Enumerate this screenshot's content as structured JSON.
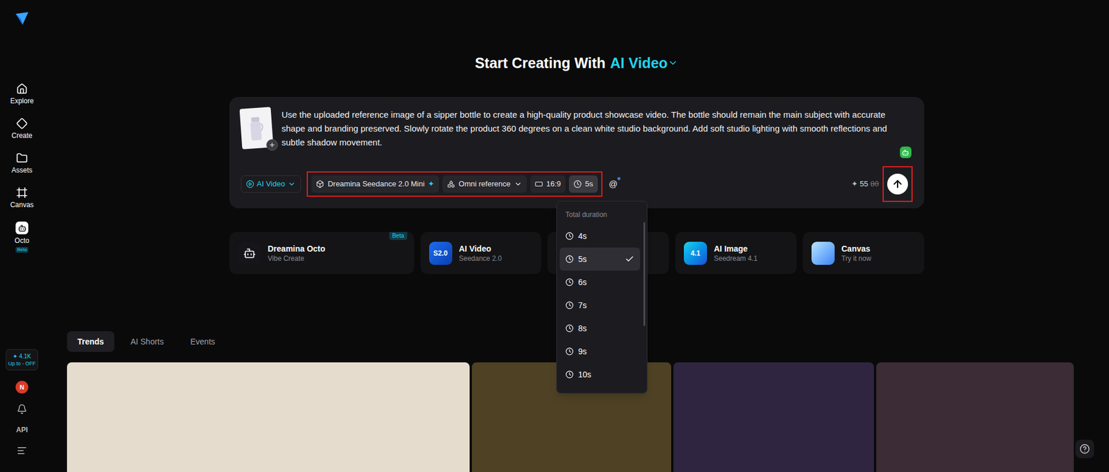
{
  "sidebar": {
    "items": [
      {
        "label": "Explore",
        "selected": false
      },
      {
        "label": "Create",
        "selected": false
      },
      {
        "label": "Assets",
        "selected": false
      },
      {
        "label": "Canvas",
        "selected": false
      },
      {
        "label": "Octo",
        "selected": false,
        "badge": "Beta"
      }
    ],
    "credits": {
      "icon": "✦",
      "amount": "4.1K",
      "promo": "Up to - OFF"
    },
    "avatar": "N",
    "api": "API"
  },
  "header": {
    "title": "Start Creating With",
    "mode": "AI Video"
  },
  "prompt": {
    "text": "Use the uploaded reference image of a sipper bottle to create a high-quality product showcase video. The bottle should remain the main subject with accurate shape and branding preserved. Slowly rotate the product 360 degrees on a clean white studio background. Add soft studio lighting with smooth reflections and subtle shadow movement.",
    "toolbar": {
      "mode": "AI Video",
      "outlined": true,
      "model": "Dreamina Seedance 2.0 Mini",
      "model_mark": "✦",
      "reference": "Omni reference",
      "ratio": "16:9",
      "duration": "5s",
      "duration_open": true,
      "mention": "@"
    },
    "cost": {
      "icon": "✦",
      "price": "55",
      "original_price": "80"
    },
    "send": {
      "outlined": true
    }
  },
  "duration_menu": {
    "title": "Total duration",
    "options": [
      {
        "label": "4s",
        "selected": false
      },
      {
        "label": "5s",
        "selected": true
      },
      {
        "label": "6s",
        "selected": false
      },
      {
        "label": "7s",
        "selected": false
      },
      {
        "label": "8s",
        "selected": false
      },
      {
        "label": "9s",
        "selected": false
      },
      {
        "label": "10s",
        "selected": false
      }
    ]
  },
  "feature_cards": [
    {
      "title": "Dreamina Octo",
      "subtitle": "Vibe Create",
      "badge": "Beta",
      "icon_text": "",
      "covered": false
    },
    {
      "title": "AI Video",
      "subtitle": "Seedance 2.0",
      "badge": "",
      "icon_text": "S2.0",
      "covered": false
    },
    {
      "title": "",
      "subtitle": "",
      "badge": "",
      "icon_text": "",
      "covered": true
    },
    {
      "title": "AI Image",
      "subtitle": "Seedream 4.1",
      "badge": "",
      "icon_text": "4.1",
      "covered": false
    },
    {
      "title": "Canvas",
      "subtitle": "Try it now",
      "badge": "",
      "icon_text": "",
      "covered": false
    }
  ],
  "tabs": [
    {
      "label": "Trends",
      "selected": true
    },
    {
      "label": "AI Shorts",
      "selected": false
    },
    {
      "label": "Events",
      "selected": false
    }
  ],
  "gallery": [
    {
      "kind": "photo"
    },
    {
      "kind": "photo"
    },
    {
      "kind": "photo"
    },
    {
      "kind": "photo"
    }
  ]
}
